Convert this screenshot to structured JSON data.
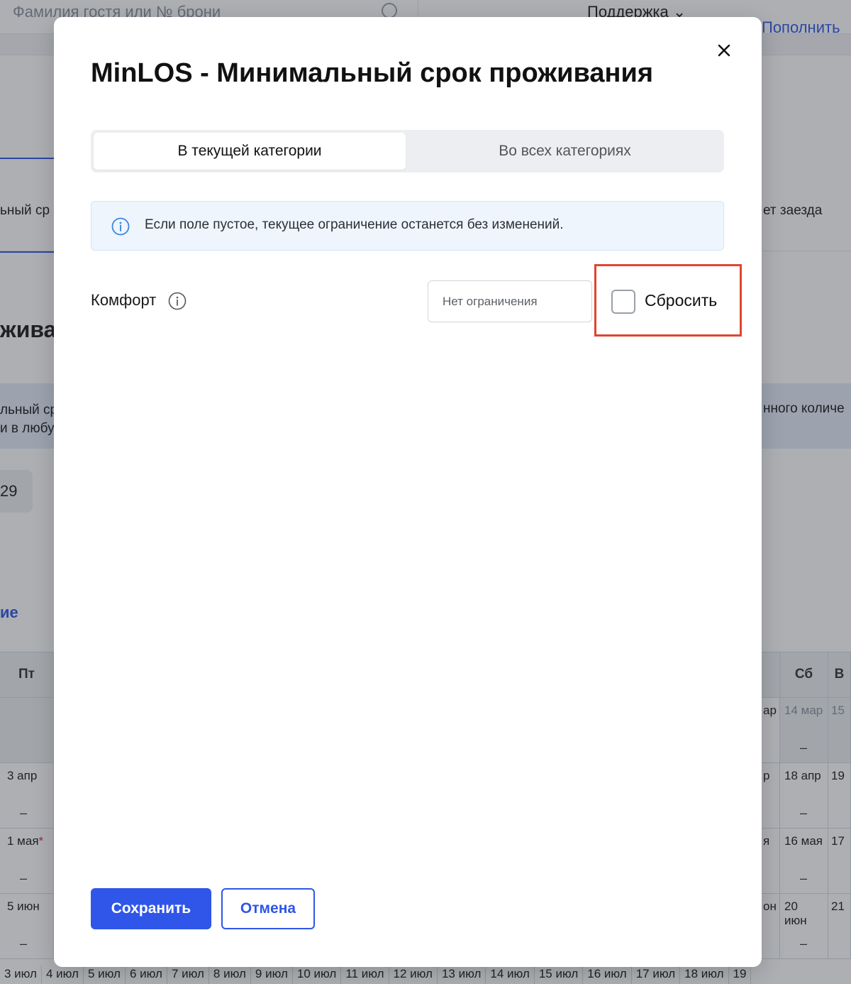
{
  "background": {
    "search_placeholder": "Фамилия гостя или № брони",
    "support_label": "Поддержка",
    "topup_link": "Пополнить",
    "left_partial_1": "ьный ср",
    "right_partial_1": "ет заезда",
    "heading_partial": "живаі",
    "info_left_line1": "льный ср",
    "info_left_line2": "и в любу",
    "info_right": "нного количе",
    "chip_value": "29",
    "link_partial": "ие",
    "calendar": {
      "left_header": "Пт",
      "right_header": "Сб",
      "right_header_next": "В",
      "left_dates": [
        "3 апр",
        "1 мая",
        "5 июн"
      ],
      "right_partial_dates": [
        "ар",
        "р",
        "я",
        "он"
      ],
      "right_dates": [
        "14 мар",
        "18 апр",
        "16 мая",
        "20 июн"
      ],
      "right_next_dates": [
        "15",
        "19",
        "17",
        "21"
      ],
      "dash": "–",
      "holiday_marker": "*",
      "bottom_row": [
        "3 июл",
        "4 июл",
        "5 июл",
        "6 июл",
        "7 июл",
        "8 июл",
        "9 июл",
        "10 июл",
        "11 июл",
        "12 июл",
        "13 июл",
        "14 июл",
        "15 июл",
        "16 июл",
        "17 июл",
        "18 июл",
        "19"
      ]
    }
  },
  "modal": {
    "title": "MinLOS - Минимальный срок проживания",
    "close_icon": "close-icon",
    "tabs": [
      {
        "label": "В текущей категории",
        "active": true
      },
      {
        "label": "Во всех категориях",
        "active": false
      }
    ],
    "note": {
      "icon": "info-icon",
      "text": "Если поле пустое, текущее ограничение останется без изменений."
    },
    "row": {
      "category_label": "Комфорт",
      "input_value": "",
      "input_placeholder": "Нет ограничения",
      "reset_checked": false,
      "reset_label": "Сбросить"
    },
    "buttons": {
      "save": "Сохранить",
      "cancel": "Отмена"
    }
  },
  "colors": {
    "accent": "#2f56e8",
    "highlight": "#e0452e",
    "note_bg": "#eef5fd"
  }
}
